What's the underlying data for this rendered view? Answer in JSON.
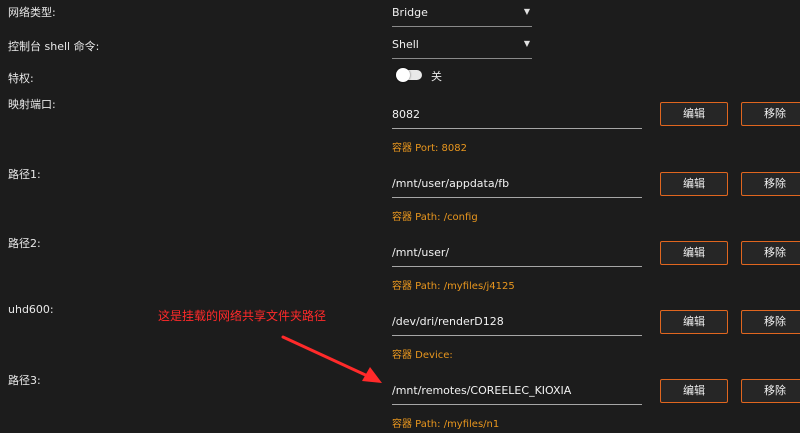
{
  "fields": {
    "network_type": {
      "label": "网络类型:",
      "value": "Bridge"
    },
    "console_shell": {
      "label": "控制台 shell 命令:",
      "value": "Shell"
    },
    "privileged": {
      "label": "特权:",
      "state_label": "关",
      "on": false
    },
    "port_mapping": {
      "label": "映射端口:",
      "value": "8082",
      "hint": "容器 Port: 8082"
    },
    "path1": {
      "label": "路径1:",
      "value": "/mnt/user/appdata/fb",
      "hint": "容器 Path: /config"
    },
    "path2": {
      "label": "路径2:",
      "value": "/mnt/user/",
      "hint": "容器 Path: /myfiles/j4125"
    },
    "uhd600": {
      "label": "uhd600:",
      "value": "/dev/dri/renderD128",
      "hint": "容器 Device:"
    },
    "path3": {
      "label": "路径3:",
      "value": "/mnt/remotes/COREELEC_KIOXIA",
      "hint": "容器 Path: /myfiles/n1"
    }
  },
  "buttons": {
    "edit": "编辑",
    "remove": "移除"
  },
  "annotation": {
    "text": "这是挂载的网络共享文件夹路径",
    "color": "#ff2a2a"
  },
  "colors": {
    "accent": "#e0661f",
    "hint": "#e8961e",
    "background": "#1c1c1c"
  }
}
